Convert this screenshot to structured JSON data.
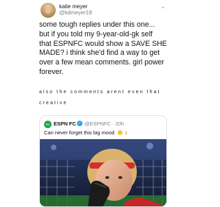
{
  "tweet": {
    "author_name": "katie meyer",
    "author_handle": "@kdmeyer19",
    "more_icon": "ellipsis-icon",
    "body_lines": [
      "some tough replies under this one...",
      "but if you told my 9-year-old-gk self",
      "that ESPNFC would show a SAVE SHE",
      "MADE? i think she'd find a way to get",
      "over a few mean comments. girl power",
      "forever."
    ],
    "spaced_lines": [
      "also the comments arent even that",
      "creative"
    ]
  },
  "quote": {
    "logo_text": "FC",
    "account_name": "ESPN FC",
    "handle_time": "@ESPNFC · 20h",
    "text": "Can never forget this big mood",
    "emojis": [
      "upside-down-face-emoji",
      "key-emoji"
    ],
    "image": "goalkeeper-photo"
  },
  "colors": {
    "secondary_text": "#7a7f84",
    "verified": "#1da1f2",
    "espn_green": "#25a24a"
  }
}
